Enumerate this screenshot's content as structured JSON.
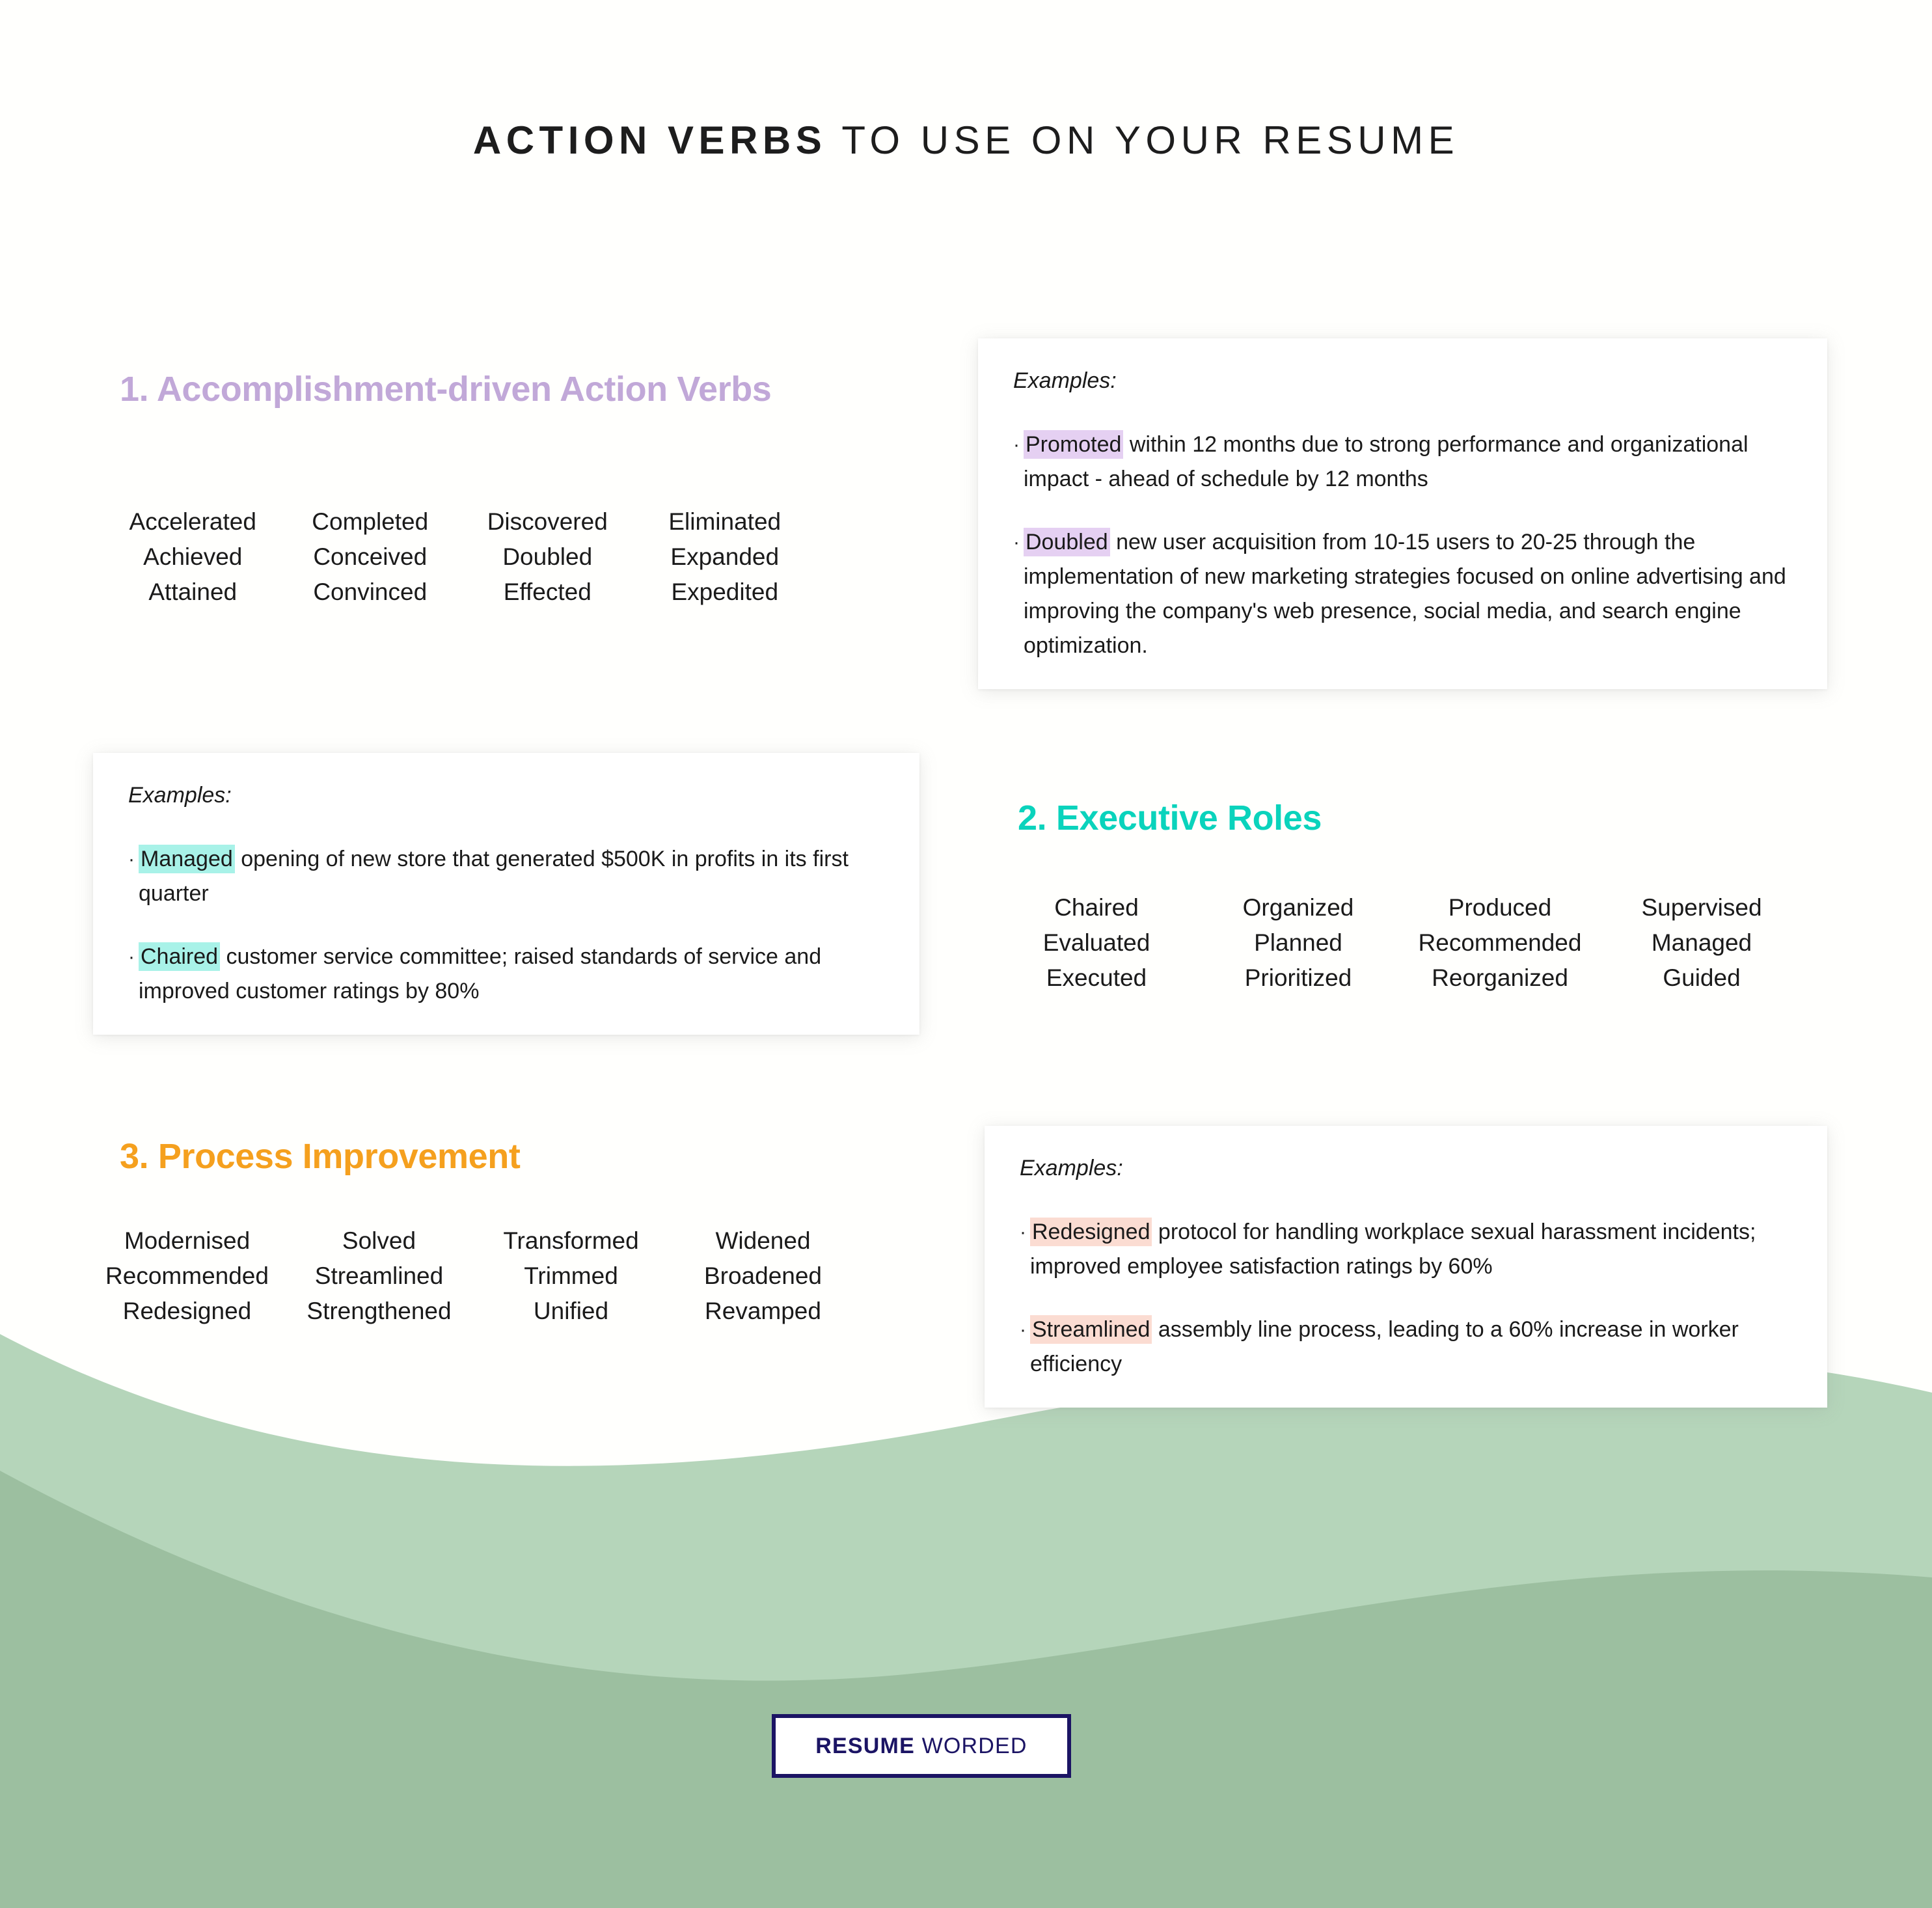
{
  "page": {
    "background_color": "#fffffd"
  },
  "header": {
    "title_bold": "ACTION VERBS",
    "title_light": " TO USE ON YOUR RESUME"
  },
  "theme": {
    "purple": "#c1a8d8",
    "teal": "#0ad3bc",
    "orange": "#f5a01e",
    "navy": "#1b1464",
    "highlight_purple": "#e5d0f2",
    "highlight_teal": "#a8f2e8",
    "highlight_peach": "#fbdcd2",
    "wave_light_green": "#b5d5ba",
    "wave_dark_green": "#9cbfa0",
    "text": "#1a1a1a"
  },
  "sections": [
    {
      "id": "accomplishment-driven-action-verbs",
      "heading": "1. Accomplishment-driven Action Verbs",
      "color": "#c1a8d8",
      "columns": [
        [
          "Accelerated",
          "Achieved",
          "Attained"
        ],
        [
          "Completed",
          "Conceived",
          "Convinced"
        ],
        [
          "Discovered",
          "Doubled",
          "Effected"
        ],
        [
          "Eliminated",
          "Expanded",
          "Expedited"
        ]
      ]
    },
    {
      "id": "executive-roles",
      "heading": "2. Executive Roles",
      "color": "#0ad3bc",
      "columns": [
        [
          "Chaired",
          "Evaluated",
          "Executed"
        ],
        [
          "Organized",
          "Planned",
          "Prioritized"
        ],
        [
          "Produced",
          "Recommended",
          "Reorganized"
        ],
        [
          "Supervised",
          "Managed",
          "Guided"
        ]
      ]
    },
    {
      "id": "process-improvement",
      "heading": "3. Process Improvement",
      "color": "#f5a01e",
      "columns": [
        [
          "Modernised",
          "Recommended",
          "Redesigned"
        ],
        [
          "Solved",
          "Streamlined",
          "Strengthened"
        ],
        [
          "Transformed",
          "Trimmed",
          "Unified"
        ],
        [
          "Widened",
          "Broadened",
          "Revamped"
        ]
      ]
    }
  ],
  "cards": [
    {
      "id": "examples-accomplishment",
      "label": "Examples:",
      "highlight_style": "hl-purple",
      "bullets": [
        {
          "marker": "·",
          "highlight": "Promoted",
          "rest": " within 12 months due to strong performance and organizational impact - ahead of schedule by 12 months"
        },
        {
          "marker": "·",
          "highlight": "Doubled",
          "rest": " new user acquisition from 10-15 users to 20-25 through the implementation of new marketing strategies focused on online advertising and improving the company's web presence, social media, and search engine optimization."
        }
      ]
    },
    {
      "id": "examples-executive",
      "label": "Examples:",
      "highlight_style": "hl-teal",
      "bullets": [
        {
          "marker": "·",
          "highlight": "Managed",
          "rest": " opening of new store that generated $500K in profits in its first quarter"
        },
        {
          "marker": "·",
          "highlight": "Chaired",
          "rest": " customer service committee; raised standards of service and improved customer ratings by 80%"
        }
      ]
    },
    {
      "id": "examples-process",
      "label": "Examples:",
      "highlight_style": "hl-peach",
      "bullets": [
        {
          "marker": "·",
          "highlight": "Redesigned",
          "rest": " protocol for handling workplace sexual harassment incidents; improved employee satisfaction ratings by 60%"
        },
        {
          "marker": "·",
          "highlight": "Streamlined",
          "rest": " assembly line process, leading to a 60% increase in worker efficiency"
        }
      ]
    }
  ],
  "footer": {
    "logo_bold": "RESUME",
    "logo_regular": " WORDED"
  }
}
